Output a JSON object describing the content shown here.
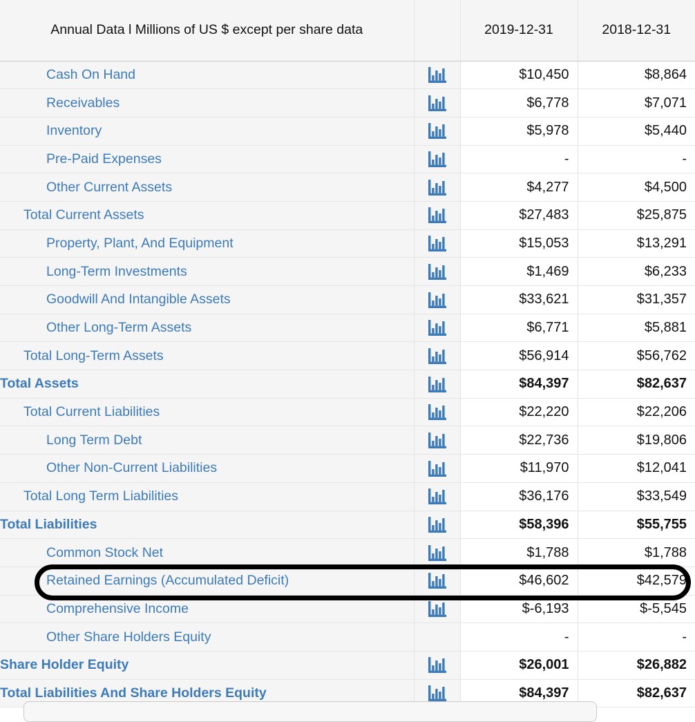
{
  "table": {
    "header": {
      "label_column": "Annual Data l Millions of US $ except per share data",
      "icon_column": "",
      "periods": [
        "2019-12-31",
        "2018-12-31"
      ]
    },
    "icon": {
      "name": "bar-chart-icon",
      "color": "#3d7ab8"
    },
    "colors": {
      "link_blue": "#3d7ab8",
      "row_background": "#f5f5f5",
      "value_background": "#ffffff",
      "text_dark": "#111111",
      "annotation": "#000000"
    },
    "rows": [
      {
        "label": "Cash On Hand",
        "indent": 2,
        "bold": false,
        "icon": true,
        "values": [
          "$10,450",
          "$8,864"
        ]
      },
      {
        "label": "Receivables",
        "indent": 2,
        "bold": false,
        "icon": true,
        "values": [
          "$6,778",
          "$7,071"
        ]
      },
      {
        "label": "Inventory",
        "indent": 2,
        "bold": false,
        "icon": true,
        "values": [
          "$5,978",
          "$5,440"
        ]
      },
      {
        "label": "Pre-Paid Expenses",
        "indent": 2,
        "bold": false,
        "icon": true,
        "values": [
          "-",
          "-"
        ]
      },
      {
        "label": "Other Current Assets",
        "indent": 2,
        "bold": false,
        "icon": true,
        "values": [
          "$4,277",
          "$4,500"
        ]
      },
      {
        "label": "Total Current Assets",
        "indent": 1,
        "bold": false,
        "icon": true,
        "values": [
          "$27,483",
          "$25,875"
        ]
      },
      {
        "label": "Property, Plant, And Equipment",
        "indent": 2,
        "bold": false,
        "icon": true,
        "values": [
          "$15,053",
          "$13,291"
        ]
      },
      {
        "label": "Long-Term Investments",
        "indent": 2,
        "bold": false,
        "icon": true,
        "values": [
          "$1,469",
          "$6,233"
        ]
      },
      {
        "label": "Goodwill And Intangible Assets",
        "indent": 2,
        "bold": false,
        "icon": true,
        "values": [
          "$33,621",
          "$31,357"
        ]
      },
      {
        "label": "Other Long-Term Assets",
        "indent": 2,
        "bold": false,
        "icon": true,
        "values": [
          "$6,771",
          "$5,881"
        ]
      },
      {
        "label": "Total Long-Term Assets",
        "indent": 1,
        "bold": false,
        "icon": true,
        "values": [
          "$56,914",
          "$56,762"
        ]
      },
      {
        "label": "Total Assets",
        "indent": 0,
        "bold": true,
        "icon": true,
        "values": [
          "$84,397",
          "$82,637"
        ]
      },
      {
        "label": "Total Current Liabilities",
        "indent": 1,
        "bold": false,
        "icon": true,
        "values": [
          "$22,220",
          "$22,206"
        ]
      },
      {
        "label": "Long Term Debt",
        "indent": 2,
        "bold": false,
        "icon": true,
        "values": [
          "$22,736",
          "$19,806"
        ]
      },
      {
        "label": "Other Non-Current Liabilities",
        "indent": 2,
        "bold": false,
        "icon": true,
        "values": [
          "$11,970",
          "$12,041"
        ]
      },
      {
        "label": "Total Long Term Liabilities",
        "indent": 1,
        "bold": false,
        "icon": true,
        "values": [
          "$36,176",
          "$33,549"
        ]
      },
      {
        "label": "Total Liabilities",
        "indent": 0,
        "bold": true,
        "icon": true,
        "values": [
          "$58,396",
          "$55,755"
        ]
      },
      {
        "label": "Common Stock Net",
        "indent": 2,
        "bold": false,
        "icon": true,
        "values": [
          "$1,788",
          "$1,788"
        ]
      },
      {
        "label": "Retained Earnings (Accumulated Deficit)",
        "indent": 2,
        "bold": false,
        "icon": true,
        "values": [
          "$46,602",
          "$42,579"
        ],
        "highlighted": true
      },
      {
        "label": "Comprehensive Income",
        "indent": 2,
        "bold": false,
        "icon": true,
        "values": [
          "$-6,193",
          "$-5,545"
        ]
      },
      {
        "label": "Other Share Holders Equity",
        "indent": 2,
        "bold": false,
        "icon": false,
        "values": [
          "-",
          "-"
        ]
      },
      {
        "label": "Share Holder Equity",
        "indent": 0,
        "bold": true,
        "icon": true,
        "values": [
          "$26,001",
          "$26,882"
        ]
      },
      {
        "label": "Total Liabilities And Share Holders Equity",
        "indent": 0,
        "bold": true,
        "icon": true,
        "values": [
          "$84,397",
          "$82,637"
        ]
      }
    ]
  }
}
